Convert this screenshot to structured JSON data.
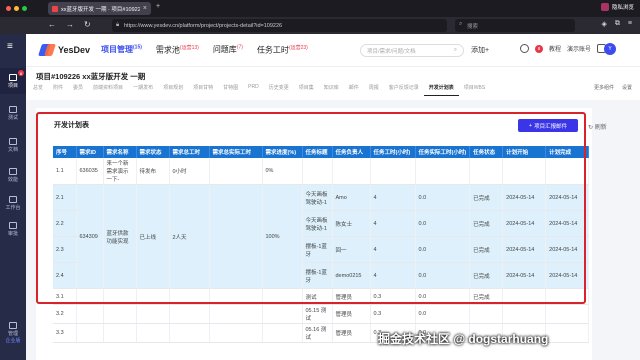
{
  "browser": {
    "tab_title": "xx蓝牙版开发 一期 · 项目#10922...",
    "url": "https://www.yesdev.cn/platform/project/projects-detail?id=109226",
    "search_placeholder": "搜索",
    "profile_label": "隐私浏览"
  },
  "sidebar": {
    "items": [
      {
        "label": "项目",
        "badge": "8"
      },
      {
        "label": "测试"
      },
      {
        "label": "文档"
      },
      {
        "label": "效能"
      },
      {
        "label": "工作台"
      },
      {
        "label": "审批"
      }
    ],
    "bottom_label": "管理",
    "bottom_sub": "企业版"
  },
  "header": {
    "logo": "YesDev",
    "nav": [
      {
        "label": "项目管理",
        "count": "(15)"
      },
      {
        "label": "需求池",
        "count": "(运营13)"
      },
      {
        "label": "问题库",
        "count": "(7)"
      },
      {
        "label": "任务工时",
        "count": "(运营23)"
      }
    ],
    "search_placeholder": "项目/需求/问题/文档",
    "add_label": "添加+",
    "notice_count": "8",
    "tutorial_label": "教程",
    "account_label": "演示账号"
  },
  "project": {
    "title": "项目#109226  xx蓝牙版开发 一期",
    "tabs": [
      "总览",
      "附件",
      "委员",
      "前端资料项目",
      "一期发布",
      "项目规划",
      "项目甘特",
      "甘特图",
      "PRD",
      "历史变更",
      "项目集",
      "知识库",
      "邮件",
      "周报",
      "客户反馈记录",
      "开发计划表",
      "项目WBS"
    ],
    "active_tab": "开发计划表",
    "tabs_right_more": "更多组件",
    "tabs_right_settings": "设置"
  },
  "plan": {
    "title": "开发计划表",
    "export_label": "项目汇报邮件",
    "refresh_label": "刷新",
    "columns": [
      "序号",
      "需求ID",
      "需求名称",
      "需求状态",
      "需求总工时",
      "需求总实际工时",
      "需求进度(%)",
      "任务标题",
      "任务负责人",
      "任务工时(小时)",
      "任务实际工时(小时)",
      "任务状态",
      "计划开始",
      "计划完成"
    ],
    "row_11": {
      "no": "1.1",
      "id": "636035",
      "name": "来一个新需求演示一下-",
      "status": "待发布",
      "hours": "0小时",
      "actual": "",
      "progress": "0%"
    },
    "group_634309": {
      "id": "634309",
      "name": "蓝牙供款功能实现",
      "status": "已上线",
      "hours": "2人天",
      "actual": "",
      "progress": "100%"
    },
    "rows_2x": [
      {
        "no": "2.1",
        "task": "今天画板驾驶动-1",
        "owner": "Amo",
        "h": "4",
        "ah": "0.0",
        "st": "已完成",
        "start": "2024-05-14",
        "end": "2024-05-14"
      },
      {
        "no": "2.2",
        "task": "今天画板驾驶动-1",
        "owner": "陈女士",
        "h": "4",
        "ah": "0.0",
        "st": "已完成",
        "start": "2024-05-14",
        "end": "2024-05-14"
      },
      {
        "no": "2.3",
        "task": "摆板-1蓝牙",
        "owner": "回一",
        "h": "4",
        "ah": "0.0",
        "st": "已完成",
        "start": "2024-05-14",
        "end": "2024-05-14"
      },
      {
        "no": "2.4",
        "task": "摆板-1蓝牙",
        "owner": "demo0215",
        "h": "4",
        "ah": "0.0",
        "st": "已完成",
        "start": "2024-05-14",
        "end": "2024-05-14"
      }
    ],
    "rows_3x": [
      {
        "no": "3.1",
        "task": "测试",
        "owner": "管理员",
        "h": "0.3",
        "ah": "0.0",
        "st": "已完成"
      },
      {
        "no": "3.2",
        "task": "05.15 测试",
        "owner": "管理员",
        "h": "0.3",
        "ah": "0.0",
        "st": ""
      },
      {
        "no": "3.3",
        "task": "05.16 测试",
        "owner": "管理员",
        "h": "0.3",
        "ah": "0.0",
        "st": ""
      }
    ]
  },
  "watermark": "掘金技术社区 @ dogstarhuang",
  "colors": {
    "accent": "#3a36e8",
    "header_blue": "#1973d1",
    "highlight": "#d8232a",
    "done": "#2fb344"
  }
}
